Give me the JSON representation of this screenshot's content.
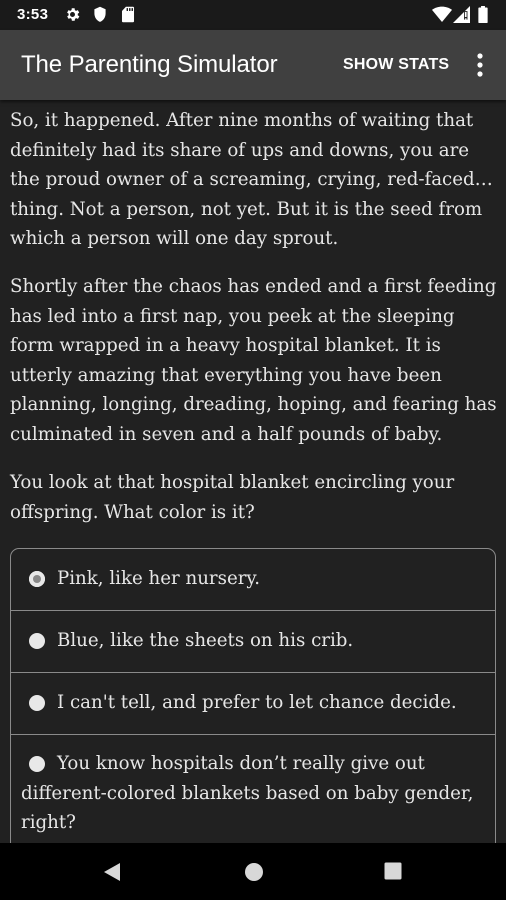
{
  "status_bar": {
    "time": "3:53",
    "left_icons": [
      "settings-gear-icon",
      "shield-icon",
      "sd-card-icon"
    ],
    "right_icons": [
      "wifi-icon",
      "signal-icon",
      "battery-icon"
    ]
  },
  "app_bar": {
    "title": "The Parenting Simulator",
    "show_stats_label": "SHOW STATS",
    "overflow_icon": "more-vert-icon"
  },
  "story": {
    "paragraphs": [
      "So, it happened. After nine months of waiting that definitely had its share of ups and downs, you are the proud owner of a screaming, crying, red-faced… thing. Not a person, not yet. But it is the seed from which a person will one day sprout.",
      "Shortly after the chaos has ended and a first feeding has led into a first nap, you peek at the sleeping form wrapped in a heavy hospital blanket. It is utterly amazing that everything you have been planning, longing, dreading, hoping, and fearing has culminated in seven and a half pounds of baby.",
      "You look at that hospital blanket encircling your offspring. What color is it?"
    ]
  },
  "choices": [
    {
      "label": "Pink, like her nursery.",
      "selected": true
    },
    {
      "label": "Blue, like the sheets on his crib.",
      "selected": false
    },
    {
      "label": "I can't tell, and prefer to let chance decide.",
      "selected": false
    },
    {
      "label": "You know hospitals don’t really give out different-colored blankets based on baby gender, right?",
      "selected": false
    }
  ],
  "nav_bar": {
    "icons": [
      "back-icon",
      "home-icon",
      "recents-icon"
    ]
  }
}
